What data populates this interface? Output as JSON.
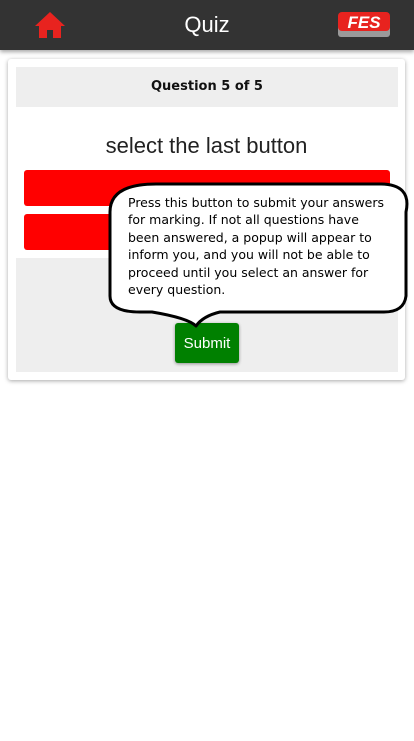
{
  "header": {
    "title": "Quiz",
    "home_icon": "home-icon",
    "logo_text": "FES",
    "accent": "#e8231f",
    "bar_color": "#333333"
  },
  "quiz": {
    "question_label": "Question 5 of 5",
    "prompt": "select the last button",
    "answer_color": "#ff0000",
    "submit_label": "Submit",
    "submit_color": "#008000"
  },
  "tooltip": {
    "text": "Press this button to submit your answers for marking. If not all questions have been answered, a popup will appear to inform you, and you will not be able to proceed until you select an answer for every question."
  }
}
